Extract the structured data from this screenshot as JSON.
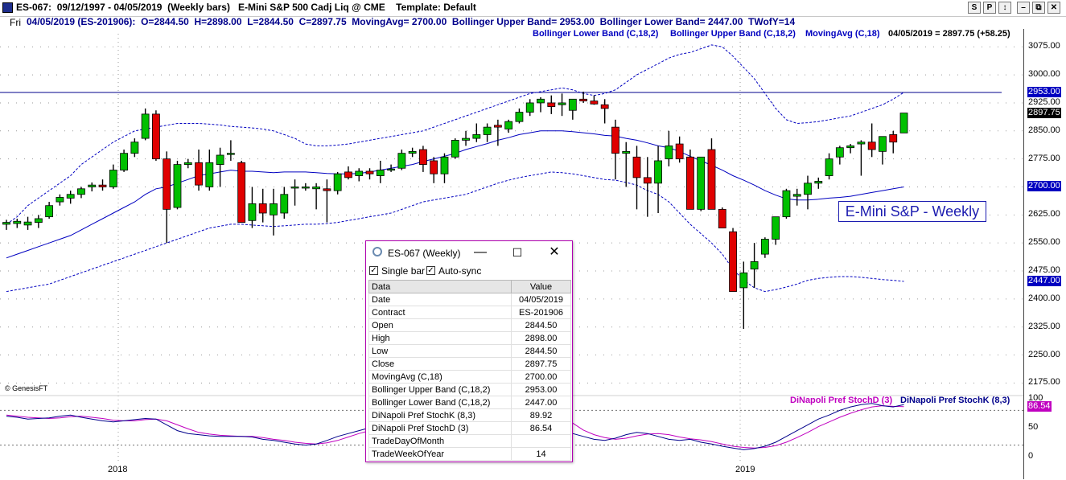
{
  "window": {
    "title": "ES-067:  09/12/1997 - 04/05/2019  (Weekly bars)   E-Mini S&P 500 Cadj Liq @ CME    Template: Default",
    "buttons": [
      "S",
      "P",
      "↕",
      "–",
      "⧉",
      "✕"
    ]
  },
  "infobar": {
    "day": "Fri",
    "text": "04/05/2019 (ES-201906):  O=2844.50  H=2898.00  L=2844.50  C=2897.75  MovingAvg= 2700.00  Bollinger Upper Band= 2953.00  Bollinger Lower Band= 2447.00  TWofY=14"
  },
  "legend": {
    "lower": "Bollinger Lower Band (C,18,2)",
    "upper": "Bollinger Upper Band (C,18,2)",
    "ma": "MovingAvg (C,18)",
    "last": "04/05/2019 = 2897.75 (+58.25)"
  },
  "colors": {
    "up": "#00c000",
    "down": "#e00000",
    "band": "#0000c0",
    "stochK": "#00008b",
    "stochD": "#c000c0",
    "hline": "#00008b"
  },
  "chart_label": "E-Mini S&P - Weekly",
  "genesis": "© GenesisFT",
  "years": [
    "2018",
    "2019"
  ],
  "indicator_legend": {
    "d": "DiNapoli Pref StochD (3)",
    "k": "DiNapoli Pref StochK (8,3)"
  },
  "popup": {
    "title": "ES-067 (Weekly)",
    "single_bar": "Single bar",
    "auto_sync": "Auto-sync",
    "header": [
      "Data",
      "Value"
    ],
    "rows": [
      [
        "Date",
        "04/05/2019"
      ],
      [
        "Contract",
        "ES-201906"
      ],
      [
        "Open",
        "2844.50"
      ],
      [
        "High",
        "2898.00"
      ],
      [
        "Low",
        "2844.50"
      ],
      [
        "Close",
        "2897.75"
      ],
      [
        "MovingAvg (C,18)",
        "2700.00"
      ],
      [
        "Bollinger Upper Band (C,18,2)",
        "2953.00"
      ],
      [
        "Bollinger Lower Band (C,18,2)",
        "2447.00"
      ],
      [
        "DiNapoli Pref StochK (8,3)",
        "89.92"
      ],
      [
        "DiNapoli Pref StochD (3)",
        "86.54"
      ],
      [
        "TradeDayOfMonth",
        ""
      ],
      [
        "TradeWeekOfYear",
        "14"
      ]
    ]
  },
  "chart_data": {
    "type": "candlestick",
    "price_axis": {
      "ticks": [
        "3075.00",
        "3000.00",
        "2925.00",
        "2850.00",
        "2775.00",
        "2700.00",
        "2625.00",
        "2550.00",
        "2475.00",
        "2400.00",
        "2325.00",
        "2250.00",
        "2175.00"
      ],
      "ylim": [
        2150,
        3110
      ],
      "highlight": [
        {
          "value": 2953,
          "label": "2953.00"
        },
        {
          "value": 2897.75,
          "label": "2897.75"
        },
        {
          "value": 2700,
          "label": "2700.00"
        },
        {
          "value": 2447,
          "label": "2447.00"
        }
      ],
      "horizontal_line": 2953
    },
    "indicator_axis": {
      "ticks": [
        "100",
        "50",
        "0"
      ],
      "ylim": [
        0,
        100
      ],
      "highlight": {
        "value": 86.54,
        "label": "86.54"
      },
      "ref_lines": [
        20,
        80
      ]
    },
    "candles": [
      [
        2600,
        2612,
        2585,
        2605
      ],
      [
        2602,
        2615,
        2590,
        2608
      ],
      [
        2598,
        2620,
        2585,
        2606
      ],
      [
        2605,
        2625,
        2590,
        2615
      ],
      [
        2620,
        2660,
        2615,
        2650
      ],
      [
        2660,
        2680,
        2650,
        2672
      ],
      [
        2670,
        2690,
        2655,
        2680
      ],
      [
        2680,
        2700,
        2670,
        2695
      ],
      [
        2700,
        2712,
        2688,
        2705
      ],
      [
        2705,
        2720,
        2690,
        2700
      ],
      [
        2700,
        2760,
        2695,
        2745
      ],
      [
        2745,
        2800,
        2740,
        2790
      ],
      [
        2790,
        2830,
        2780,
        2820
      ],
      [
        2830,
        2910,
        2825,
        2895
      ],
      [
        2895,
        2905,
        2770,
        2775
      ],
      [
        2775,
        2795,
        2550,
        2640
      ],
      [
        2645,
        2770,
        2640,
        2760
      ],
      [
        2760,
        2775,
        2750,
        2765
      ],
      [
        2765,
        2800,
        2690,
        2705
      ],
      [
        2700,
        2800,
        2690,
        2765
      ],
      [
        2760,
        2805,
        2700,
        2785
      ],
      [
        2790,
        2825,
        2770,
        2790
      ],
      [
        2765,
        2770,
        2610,
        2605
      ],
      [
        2610,
        2700,
        2590,
        2655
      ],
      [
        2655,
        2695,
        2605,
        2630
      ],
      [
        2625,
        2695,
        2570,
        2655
      ],
      [
        2630,
        2700,
        2615,
        2680
      ],
      [
        2700,
        2720,
        2650,
        2700
      ],
      [
        2700,
        2710,
        2690,
        2700
      ],
      [
        2695,
        2710,
        2640,
        2700
      ],
      [
        2695,
        2720,
        2605,
        2690
      ],
      [
        2690,
        2740,
        2680,
        2735
      ],
      [
        2740,
        2755,
        2720,
        2725
      ],
      [
        2730,
        2750,
        2715,
        2742
      ],
      [
        2742,
        2750,
        2720,
        2735
      ],
      [
        2730,
        2770,
        2710,
        2745
      ],
      [
        2745,
        2760,
        2740,
        2748
      ],
      [
        2750,
        2800,
        2745,
        2790
      ],
      [
        2790,
        2805,
        2780,
        2795
      ],
      [
        2800,
        2810,
        2740,
        2760
      ],
      [
        2770,
        2780,
        2710,
        2735
      ],
      [
        2735,
        2790,
        2710,
        2780
      ],
      [
        2780,
        2830,
        2775,
        2825
      ],
      [
        2825,
        2850,
        2810,
        2830
      ],
      [
        2830,
        2870,
        2820,
        2840
      ],
      [
        2840,
        2870,
        2820,
        2860
      ],
      [
        2865,
        2880,
        2810,
        2860
      ],
      [
        2855,
        2880,
        2845,
        2875
      ],
      [
        2875,
        2910,
        2870,
        2900
      ],
      [
        2900,
        2935,
        2890,
        2925
      ],
      [
        2925,
        2940,
        2900,
        2935
      ],
      [
        2925,
        2945,
        2895,
        2915
      ],
      [
        2920,
        2950,
        2890,
        2925
      ],
      [
        2905,
        2930,
        2880,
        2935
      ],
      [
        2935,
        2955,
        2925,
        2930
      ],
      [
        2930,
        2945,
        2920,
        2922
      ],
      [
        2920,
        2935,
        2870,
        2910
      ],
      [
        2860,
        2880,
        2720,
        2790
      ],
      [
        2790,
        2820,
        2700,
        2795
      ],
      [
        2780,
        2810,
        2640,
        2725
      ],
      [
        2725,
        2780,
        2620,
        2710
      ],
      [
        2710,
        2810,
        2630,
        2770
      ],
      [
        2775,
        2850,
        2755,
        2810
      ],
      [
        2815,
        2835,
        2765,
        2775
      ],
      [
        2780,
        2800,
        2640,
        2640
      ],
      [
        2640,
        2780,
        2635,
        2780
      ],
      [
        2800,
        2830,
        2640,
        2640
      ],
      [
        2640,
        2645,
        2590,
        2590
      ],
      [
        2580,
        2590,
        2420,
        2420
      ],
      [
        2430,
        2500,
        2320,
        2470
      ],
      [
        2480,
        2550,
        2430,
        2500
      ],
      [
        2520,
        2565,
        2510,
        2560
      ],
      [
        2560,
        2620,
        2545,
        2620
      ],
      [
        2620,
        2695,
        2615,
        2690
      ],
      [
        2675,
        2695,
        2650,
        2680
      ],
      [
        2680,
        2730,
        2640,
        2710
      ],
      [
        2710,
        2725,
        2695,
        2715
      ],
      [
        2730,
        2790,
        2720,
        2775
      ],
      [
        2780,
        2810,
        2760,
        2805
      ],
      [
        2805,
        2815,
        2790,
        2810
      ],
      [
        2815,
        2825,
        2730,
        2820
      ],
      [
        2820,
        2870,
        2780,
        2800
      ],
      [
        2795,
        2830,
        2760,
        2835
      ],
      [
        2840,
        2850,
        2790,
        2820
      ],
      [
        2844.5,
        2898,
        2844.5,
        2897.75
      ]
    ],
    "moving_avg": [
      2510,
      2520,
      2530,
      2540,
      2550,
      2560,
      2570,
      2585,
      2600,
      2615,
      2630,
      2645,
      2660,
      2680,
      2695,
      2700,
      2710,
      2720,
      2730,
      2735,
      2740,
      2745,
      2742,
      2742,
      2740,
      2738,
      2740,
      2740,
      2740,
      2738,
      2736,
      2735,
      2735,
      2736,
      2740,
      2745,
      2750,
      2755,
      2760,
      2768,
      2775,
      2782,
      2790,
      2800,
      2808,
      2816,
      2825,
      2832,
      2840,
      2845,
      2850,
      2850,
      2850,
      2848,
      2845,
      2842,
      2838,
      2836,
      2830,
      2825,
      2818,
      2810,
      2805,
      2795,
      2782,
      2770,
      2758,
      2745,
      2730,
      2718,
      2705,
      2690,
      2678,
      2668,
      2665,
      2665,
      2667,
      2670,
      2672,
      2675,
      2680,
      2685,
      2690,
      2695,
      2700
    ],
    "upper_band": [
      2600,
      2620,
      2650,
      2670,
      2690,
      2710,
      2730,
      2760,
      2780,
      2800,
      2820,
      2835,
      2850,
      2855,
      2860,
      2865,
      2870,
      2870,
      2870,
      2868,
      2866,
      2862,
      2860,
      2858,
      2855,
      2850,
      2840,
      2830,
      2815,
      2810,
      2810,
      2812,
      2815,
      2820,
      2825,
      2830,
      2835,
      2840,
      2845,
      2850,
      2860,
      2870,
      2880,
      2890,
      2900,
      2910,
      2920,
      2930,
      2940,
      2950,
      2955,
      2960,
      2965,
      2960,
      2950,
      2945,
      2950,
      2960,
      2980,
      3000,
      3015,
      3030,
      3045,
      3055,
      3060,
      3070,
      3080,
      3075,
      3050,
      3020,
      2990,
      2950,
      2910,
      2880,
      2870,
      2872,
      2875,
      2880,
      2885,
      2890,
      2900,
      2910,
      2920,
      2935,
      2953
    ],
    "lower_band": [
      2420,
      2425,
      2430,
      2435,
      2440,
      2450,
      2460,
      2470,
      2480,
      2490,
      2500,
      2510,
      2520,
      2530,
      2540,
      2550,
      2560,
      2570,
      2580,
      2590,
      2595,
      2600,
      2600,
      2598,
      2596,
      2594,
      2596,
      2598,
      2600,
      2600,
      2602,
      2605,
      2610,
      2615,
      2620,
      2625,
      2630,
      2640,
      2650,
      2660,
      2665,
      2670,
      2675,
      2680,
      2690,
      2700,
      2710,
      2718,
      2725,
      2730,
      2735,
      2740,
      2738,
      2735,
      2730,
      2725,
      2720,
      2718,
      2712,
      2705,
      2690,
      2680,
      2660,
      2630,
      2600,
      2575,
      2550,
      2520,
      2480,
      2450,
      2430,
      2420,
      2425,
      2432,
      2440,
      2450,
      2455,
      2458,
      2460,
      2460,
      2458,
      2455,
      2452,
      2450,
      2447
    ],
    "stochK": [
      70,
      68,
      65,
      66,
      67,
      70,
      72,
      68,
      65,
      62,
      60,
      62,
      64,
      66,
      65,
      55,
      45,
      40,
      38,
      36,
      35,
      35,
      35,
      34,
      30,
      28,
      25,
      22,
      20,
      22,
      28,
      35,
      40,
      45,
      50,
      55,
      60,
      65,
      70,
      72,
      74,
      76,
      78,
      80,
      82,
      84,
      86,
      88,
      90,
      88,
      82,
      72,
      55,
      40,
      35,
      30,
      28,
      32,
      38,
      42,
      40,
      35,
      30,
      28,
      30,
      25,
      22,
      18,
      15,
      12,
      14,
      18,
      25,
      35,
      45,
      55,
      65,
      72,
      80,
      86,
      90,
      92,
      88,
      86,
      89.92
    ],
    "stochD": [
      72,
      70,
      68,
      67,
      66,
      67,
      69,
      70,
      68,
      66,
      63,
      62,
      62,
      64,
      65,
      62,
      55,
      48,
      42,
      39,
      37,
      36,
      35,
      35,
      33,
      30,
      28,
      25,
      23,
      22,
      24,
      28,
      34,
      40,
      45,
      50,
      55,
      60,
      65,
      68,
      71,
      74,
      76,
      78,
      80,
      82,
      84,
      86,
      88,
      88,
      86,
      80,
      70,
      58,
      46,
      38,
      33,
      30,
      32,
      36,
      39,
      40,
      38,
      34,
      31,
      29,
      26,
      22,
      18,
      16,
      15,
      16,
      19,
      25,
      33,
      42,
      52,
      60,
      68,
      75,
      81,
      86,
      88,
      87,
      86.54
    ]
  }
}
